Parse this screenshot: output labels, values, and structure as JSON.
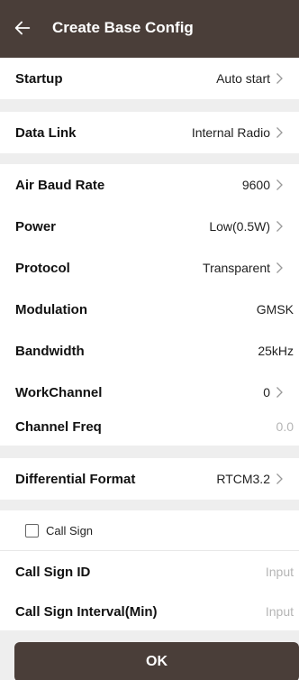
{
  "header": {
    "title": "Create Base Config",
    "back_icon": "arrow-left-icon"
  },
  "startup": {
    "label": "Startup",
    "value": "Auto start"
  },
  "data_link": {
    "label": "Data Link",
    "value": "Internal Radio"
  },
  "air_baud_rate": {
    "label": "Air Baud Rate",
    "value": "9600"
  },
  "power": {
    "label": "Power",
    "value": "Low(0.5W)"
  },
  "protocol": {
    "label": "Protocol",
    "value": "Transparent"
  },
  "modulation": {
    "label": "Modulation",
    "value": "GMSK"
  },
  "bandwidth": {
    "label": "Bandwidth",
    "value": "25kHz"
  },
  "work_channel": {
    "label": "WorkChannel",
    "value": "0"
  },
  "channel_freq": {
    "label": "Channel Freq",
    "value": "0.0"
  },
  "differential_format": {
    "label": "Differential Format",
    "value": "RTCM3.2"
  },
  "call_sign": {
    "label": "Call Sign",
    "checked": false
  },
  "call_sign_id": {
    "label": "Call Sign ID",
    "placeholder": "Input"
  },
  "call_sign_interval": {
    "label": "Call Sign Interval(Min)",
    "placeholder": "Input"
  },
  "ok_button": {
    "label": "OK"
  },
  "colors": {
    "header_bg": "#4a3e39",
    "page_bg": "#eeeeee",
    "button_bg": "#4a3e39"
  }
}
